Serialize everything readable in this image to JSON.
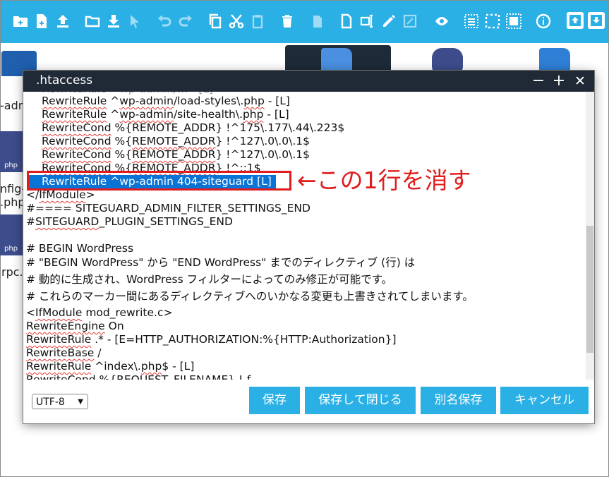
{
  "toolbar": {
    "icons": [
      "new-folder-icon",
      "new-file-icon",
      "upload-icon",
      "open-folder-icon",
      "download-icon",
      "cursor-icon",
      "undo-icon",
      "redo-icon",
      "copy-icon",
      "cut-icon",
      "paste-icon",
      "delete-icon",
      "duplicate-icon",
      "document-icon",
      "rename-icon",
      "edit-icon",
      "resize-icon",
      "preview-icon",
      "select-all-icon",
      "select-none-icon",
      "invert-selection-icon",
      "info-icon",
      "extract-icon",
      "archive-icon"
    ]
  },
  "background": {
    "labels": [
      "-adm",
      "nfig-s",
      ".php",
      "rpc.",
      "php",
      "php"
    ]
  },
  "dialog": {
    "title": ".htaccess",
    "controls": {
      "minimize": "−",
      "maximize": "+",
      "close": "✕"
    },
    "lines": [
      "RewriteRule ^wp-admin/load-styles\\.php - [L]",
      "RewriteRule ^wp-admin/site-health\\.php - [L]",
      "RewriteCond %{REMOTE_ADDR} !^175\\.177\\.44\\.223$",
      "RewriteCond %{REMOTE_ADDR} !^127\\.0\\.0\\.1$",
      "RewriteCond %{REMOTE_ADDR} !^127\\.0\\.0\\.1$",
      "RewriteCond %{REMOTE_ADDR} !^::1$",
      "RewriteRule ^wp-admin 404-siteguard [L]",
      "</IfModule>",
      "#==== SITEGUARD_ADMIN_FILTER_SETTINGS_END",
      "#SITEGUARD_PLUGIN_SETTINGS_END",
      "",
      "# BEGIN WordPress",
      "# \"BEGIN WordPress\" から \"END WordPress\" までのディレクティブ (行) は",
      "# 動的に生成され、WordPress フィルターによってのみ修正が可能です。",
      "# これらのマーカー間にあるディレクティブへのいかなる変更も上書きされてしまいます。",
      "<IfModule mod_rewrite.c>",
      "RewriteEngine On",
      "RewriteRule .* - [E=HTTP_AUTHORIZATION:%{HTTP:Authorization}]",
      "RewriteBase /",
      "RewriteRule ^index\\.php$ - [L]",
      "RewriteCond %{REQUEST_FILENAME} !-f"
    ],
    "selected_line": "RewriteRule ^wp-admin 404-siteguard [L]",
    "encoding": "UTF-8",
    "buttons": {
      "save": "保存",
      "save_close": "保存して閉じる",
      "save_as": "別名保存",
      "cancel": "キャンセル"
    }
  },
  "annotation": {
    "text": "←この1行を消す",
    "color": "#e01c1c"
  },
  "colors": {
    "accent": "#2bb0e5",
    "titlebar": "#1f2a36",
    "selection": "#0a74d6"
  }
}
